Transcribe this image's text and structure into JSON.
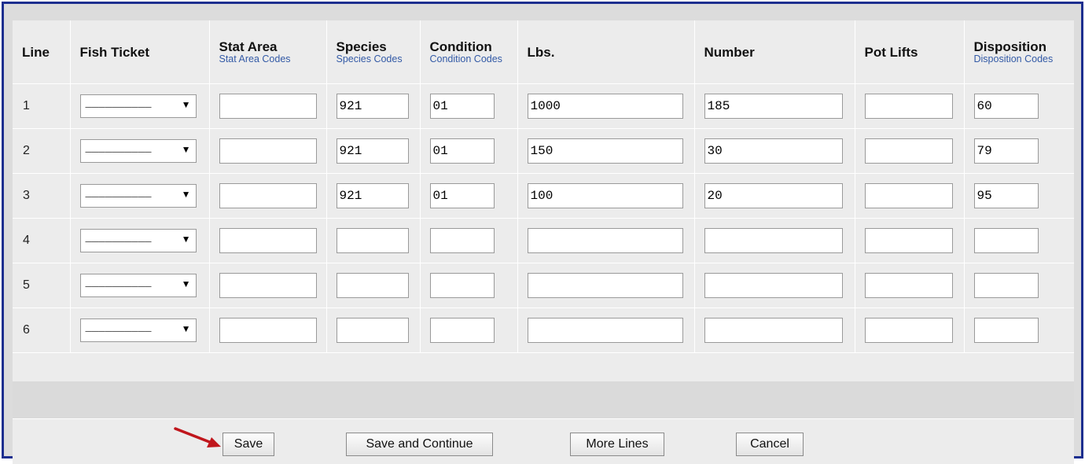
{
  "table": {
    "headers": [
      {
        "label": "Line",
        "sub": ""
      },
      {
        "label": "Fish Ticket",
        "sub": ""
      },
      {
        "label": "Stat Area",
        "sub": "Stat Area Codes"
      },
      {
        "label": "Species",
        "sub": "Species Codes"
      },
      {
        "label": "Condition",
        "sub": "Condition Codes"
      },
      {
        "label": "Lbs.",
        "sub": ""
      },
      {
        "label": "Number",
        "sub": ""
      },
      {
        "label": "Pot Lifts",
        "sub": ""
      },
      {
        "label": "Disposition",
        "sub": "Disposition Codes"
      }
    ],
    "rows": [
      {
        "line": "1",
        "fish_ticket": "__________",
        "stat_area": "",
        "species": "921",
        "condition": "01",
        "lbs": "1000",
        "number": "185",
        "pot_lifts": "",
        "disposition": "60"
      },
      {
        "line": "2",
        "fish_ticket": "__________",
        "stat_area": "",
        "species": "921",
        "condition": "01",
        "lbs": "150",
        "number": "30",
        "pot_lifts": "",
        "disposition": "79"
      },
      {
        "line": "3",
        "fish_ticket": "__________",
        "stat_area": "",
        "species": "921",
        "condition": "01",
        "lbs": "100",
        "number": "20",
        "pot_lifts": "",
        "disposition": "95"
      },
      {
        "line": "4",
        "fish_ticket": "__________",
        "stat_area": "",
        "species": "",
        "condition": "",
        "lbs": "",
        "number": "",
        "pot_lifts": "",
        "disposition": ""
      },
      {
        "line": "5",
        "fish_ticket": "__________",
        "stat_area": "",
        "species": "",
        "condition": "",
        "lbs": "",
        "number": "",
        "pot_lifts": "",
        "disposition": ""
      },
      {
        "line": "6",
        "fish_ticket": "__________",
        "stat_area": "",
        "species": "",
        "condition": "",
        "lbs": "",
        "number": "",
        "pot_lifts": "",
        "disposition": ""
      }
    ]
  },
  "buttons": {
    "save": "Save",
    "save_continue": "Save and Continue",
    "more_lines": "More Lines",
    "cancel": "Cancel"
  },
  "icons": {
    "dropdown": "caret-down-icon",
    "pointer": "red-arrow-icon"
  },
  "colors": {
    "frame_border": "#1d2f8f",
    "code_link": "#335aa6",
    "arrow": "#c0161c"
  }
}
